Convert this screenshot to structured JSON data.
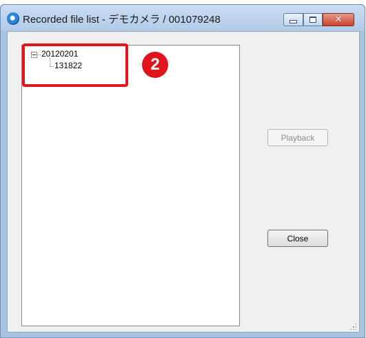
{
  "window": {
    "title": "Recorded file list - デモカメラ / 001079248",
    "close_glyph": "✕"
  },
  "tree": {
    "nodes": [
      {
        "label": "20120201",
        "expanded": true,
        "children": [
          {
            "label": "131822"
          }
        ]
      }
    ]
  },
  "annotation": {
    "badge_number": "2",
    "color": "#e0141a"
  },
  "buttons": {
    "playback_label": "Playback",
    "playback_enabled": false,
    "close_label": "Close"
  },
  "icons": {
    "app": "camera-app-icon",
    "minimize": "minimize-icon",
    "maximize": "maximize-icon",
    "close": "close-icon",
    "expander": "collapse-minus-icon",
    "grip": "resize-grip-icon"
  }
}
